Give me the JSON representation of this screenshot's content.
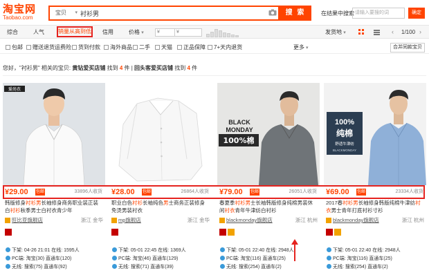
{
  "logo": {
    "main": "淘宝网",
    "sub": "Taobao.com"
  },
  "search": {
    "scope": "宝贝",
    "query": "衬衫男",
    "button": "搜 索"
  },
  "result_search": {
    "label": "在结果中搜索",
    "placeholder": "请输入要搜的词",
    "button": "确定"
  },
  "sort": {
    "items": [
      "综合",
      "人气",
      "销量从高到低",
      "信用",
      "价格"
    ],
    "price_from": "¥",
    "price_to": "¥",
    "dash": "-",
    "ship_from": "发货地",
    "page": "1/100"
  },
  "filters": {
    "options": [
      "包邮",
      "赠送退货运费险",
      "货到付款",
      "海外商品",
      "二手",
      "天猫",
      "正品保障",
      "7+天内退货"
    ],
    "more": "更多",
    "merge": "合并同款宝贝"
  },
  "hint": {
    "prefix": "您好，\"衬衫男\" 相关的宝贝: ",
    "gold": "黄钻爱买店铺",
    "found1": " 找到 ",
    "count1": "4",
    "unit1": " 件 ",
    "sep": "| ",
    "repeat": "回头客爱买店铺",
    "found2": " 找到 ",
    "count2": "4",
    "unit2": " 件"
  },
  "products": [
    {
      "price": "¥29.00",
      "baoyou": "包邮",
      "buyers": "33896人收货",
      "title_a": "韩版修身",
      "title_b": "衬衫男",
      "title_c": "长袖修身商务职业装正装白",
      "title_d": "衬衫",
      "title_e": "秋季男士白衬衣青少年",
      "shop": "旺比亚旗舰店",
      "location": "浙江 金华",
      "stat1": "下架: 04-26 21:01 在线: 1595人",
      "stat2": "PC端: 淘宝(30) 直通车(120)",
      "stat3": "无线: 搜索(75) 直通车(92)"
    },
    {
      "price": "¥28.00",
      "baoyou": "包邮",
      "buyers": "26864人收货",
      "title_a": "职业白色",
      "title_b": "衬衫",
      "title_c": "长袖纯色",
      "title_d": "男",
      "title_e": "士商务正装修身免烫男装衬衣",
      "shop": "mp旗舰店",
      "location": "浙江 金华",
      "stat1": "下架: 05-01 22:45 在线: 1369人",
      "stat2": "PC端: 淘宝(46) 直通车(129)",
      "stat3": "无线: 搜索(71) 直通车(39)"
    },
    {
      "price": "¥79.00",
      "baoyou": "包邮",
      "buyers": "26051人收货",
      "title_a": "春夏季",
      "title_b": "衬衫男",
      "title_c": "士长袖韩版修身纯棉男装休闲",
      "title_d": "衬衣",
      "title_e": "青年牛津纺白衬衫",
      "shop": "blackmonday旗舰店",
      "location": "浙江 杭州",
      "stat1": "下架: 05-01 22:40 在线: 2948人",
      "stat2": "PC端: 淘宝(116) 直通车(25)",
      "stat3": "无线: 搜索(254) 直通车(2)"
    },
    {
      "price": "¥69.00",
      "baoyou": "包邮",
      "buyers": "23334人收货",
      "title_a": "2017春",
      "title_b": "衬衫男",
      "title_c": "长袖修身韩版纯棉牛津纺",
      "title_d": "衬衣",
      "title_e": "男士青年打底衬衫寸衫",
      "shop": "blackmonday旗舰店",
      "location": "浙江 杭州",
      "stat1": "下架: 05-01 22:40 在线: 2948人",
      "stat2": "PC端: 淘宝(116) 直通车(25)",
      "stat3": "无线: 搜索(254) 直通车(2)"
    }
  ],
  "image_text": {
    "brand1": "爱尚衣",
    "bm1": "BLACK",
    "bm2": "MONDAY",
    "bm3": "100%棉",
    "p4a": "100%",
    "p4b": "纯棉",
    "p4c": "舒适牛津纺",
    "p4d": "BLACKMONDAY"
  },
  "colors": {
    "accent": "#ff4400",
    "highlight_border": "#e5221e",
    "link": "#3366cc"
  }
}
